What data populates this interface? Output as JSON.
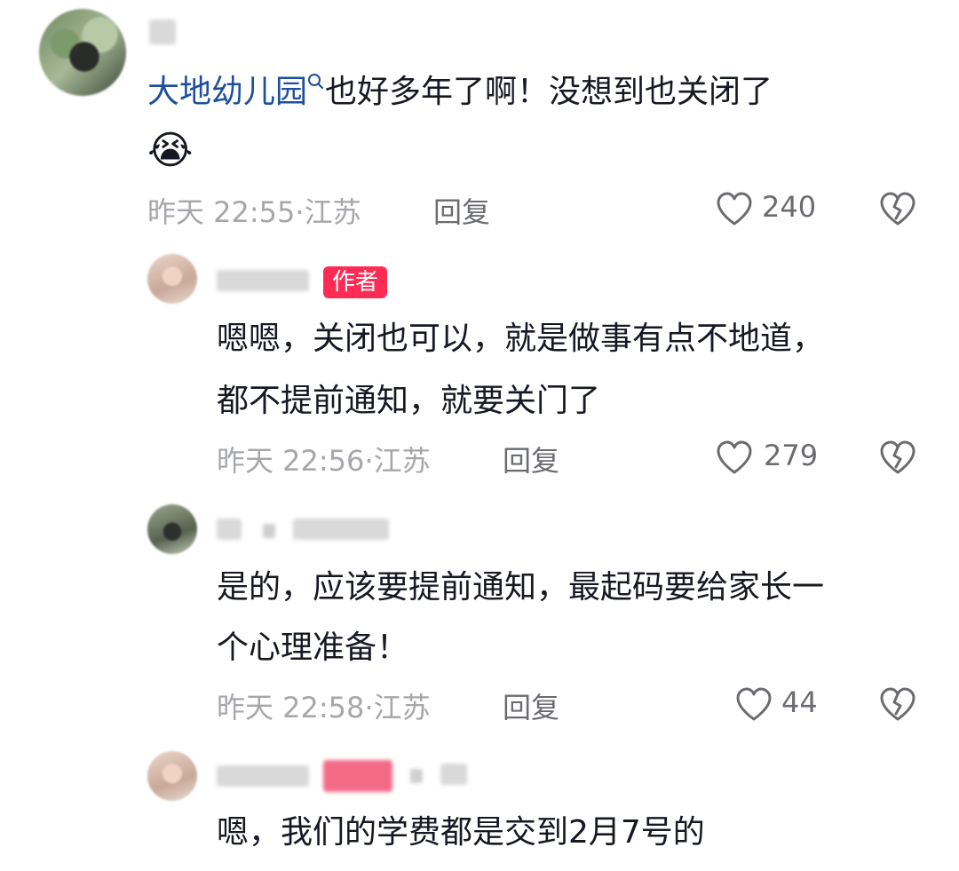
{
  "comments": [
    {
      "mention": "大地幼儿园",
      "text": "也好多年了啊！没想到也关闭了",
      "emoji": "😭",
      "time": "昨天 22:55·",
      "location": "江苏",
      "reply_label": "回复",
      "likes": "240"
    },
    {
      "author_badge": "作者",
      "line1": "嗯嗯，关闭也可以，就是做事有点不地道，",
      "line2": "都不提前通知，就要关门了",
      "time": "昨天 22:56·",
      "location": "江苏",
      "reply_label": "回复",
      "likes": "279"
    },
    {
      "line1": "是的，应该要提前通知，最起码要给家长一",
      "line2": "个心理准备！",
      "time": "昨天 22:58·",
      "location": "江苏",
      "reply_label": "回复",
      "likes": "44"
    },
    {
      "line1": "嗯，我们的学费都是交到2月7号的"
    }
  ]
}
